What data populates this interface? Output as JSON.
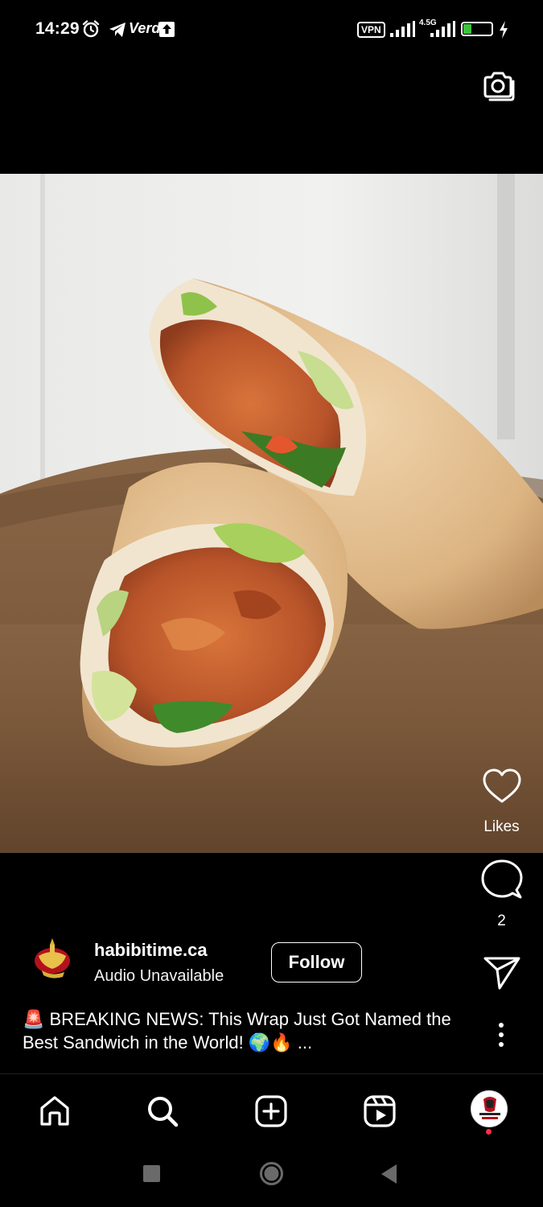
{
  "status_bar": {
    "time": "14:29",
    "carrier": "Verde",
    "vpn": "VPN",
    "network": "4.5G",
    "battery_level": 32
  },
  "post": {
    "image_icon": "food-wrap-photo",
    "likes_label": "Likes",
    "comment_count": "2",
    "username": "habibitime.ca",
    "audio_label": "Audio Unavailable",
    "follow_label": "Follow",
    "caption": "🚨 BREAKING NEWS: This Wrap Just Got Named the Best Sandwich in the World! 🌍🔥  ..."
  },
  "icons": {
    "camera": "camera-icon",
    "like": "heart-icon",
    "comment": "comment-icon",
    "share": "send-icon",
    "more": "more-vertical-icon"
  },
  "bottom_nav": {
    "items": [
      "home",
      "search",
      "create",
      "reels",
      "profile"
    ]
  },
  "colors": {
    "background": "#000000",
    "battery_fill": "#3dc23d",
    "notification_dot": "#ff3040"
  }
}
